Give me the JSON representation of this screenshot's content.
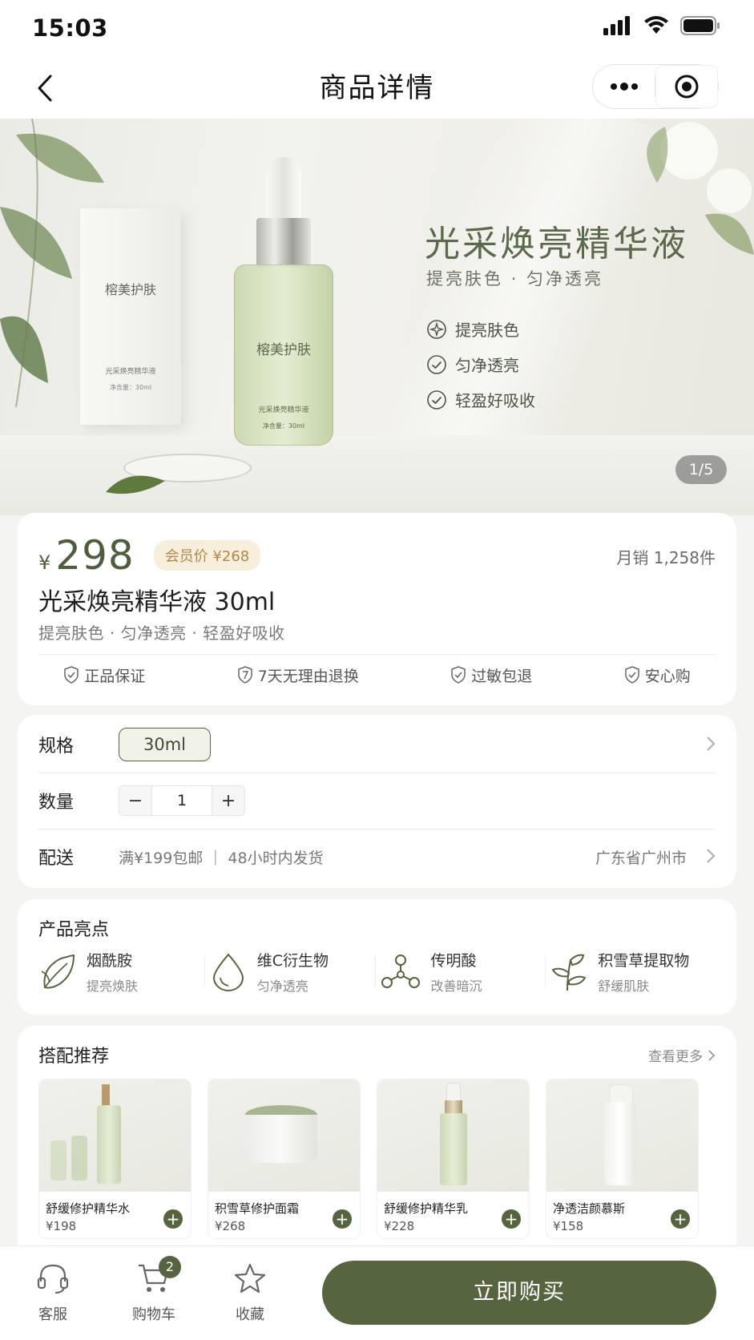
{
  "status_bar": {
    "time": "15:03"
  },
  "nav": {
    "title": "商品详情"
  },
  "hero": {
    "title": "光采焕亮精华液",
    "subtitle": "提亮肤色 · 匀净透亮",
    "features": [
      "提亮肤色",
      "匀净透亮",
      "轻盈好吸收"
    ],
    "pager": "1/5",
    "bottle_brand": "榕美护肤",
    "bottle_name": "光采焕亮精华液",
    "bottle_volume": "净含量：30ml",
    "box_brand": "榕美护肤",
    "box_name": "光采焕亮精华液",
    "box_volume": "净含量：30ml"
  },
  "product": {
    "currency": "¥",
    "price": "298",
    "member_price": "会员价 ¥268",
    "monthly_sales": "月销 1,258件",
    "name": "光采焕亮精华液 30ml",
    "description": "提亮肤色 · 匀净透亮 · 轻盈好吸收",
    "guarantees": [
      "正品保证",
      "7天无理由退换",
      "过敏包退",
      "安心购"
    ]
  },
  "options": {
    "spec_label": "规格",
    "spec_value": "30ml",
    "qty_label": "数量",
    "qty_value": "1",
    "minus": "−",
    "plus": "+",
    "ship_label": "配送",
    "ship_info": "满¥199包邮 ｜ 48小时内发货",
    "ship_region": "广东省广州市"
  },
  "highlights": {
    "title": "产品亮点",
    "items": [
      {
        "name": "烟酰胺",
        "desc": "提亮焕肤",
        "icon": "leaf-icon"
      },
      {
        "name": "维C衍生物",
        "desc": "匀净透亮",
        "icon": "drop-icon"
      },
      {
        "name": "传明酸",
        "desc": "改善暗沉",
        "icon": "molecule-icon"
      },
      {
        "name": "积雪草提取物",
        "desc": "舒缓肌肤",
        "icon": "herb-icon"
      }
    ]
  },
  "recommend": {
    "title": "搭配推荐",
    "more": "查看更多",
    "items": [
      {
        "name": "舒缓修护精华水",
        "price": "¥198"
      },
      {
        "name": "积雪草修护面霜",
        "price": "¥268"
      },
      {
        "name": "舒缓修护精华乳",
        "price": "¥228"
      },
      {
        "name": "净透洁颜慕斯",
        "price": "¥158"
      }
    ]
  },
  "tabbar": {
    "service": "客服",
    "cart": "购物车",
    "cart_badge": "2",
    "favorite": "收藏",
    "buy_now": "立即购买"
  },
  "colors": {
    "accent": "#56653f",
    "member_bg": "#f8eedc",
    "member_text": "#b0864b"
  }
}
